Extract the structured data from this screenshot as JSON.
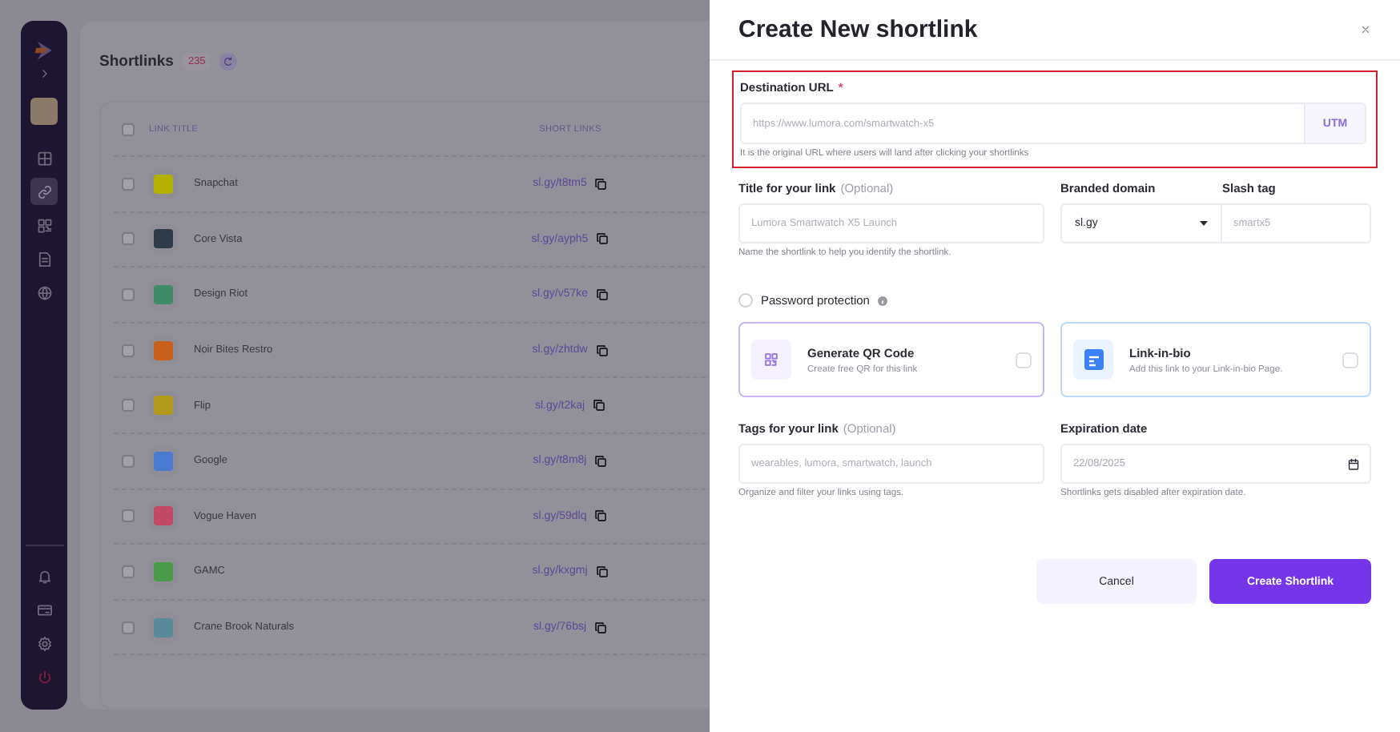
{
  "sidebar": {
    "top_items": [
      {
        "selected": false
      },
      {
        "selected": true
      },
      {
        "selected": false
      },
      {
        "selected": false
      },
      {
        "selected": false
      }
    ]
  },
  "page": {
    "title": "Shortlinks",
    "count": "235"
  },
  "table": {
    "columns": [
      "LINK TITLE",
      "SHORT LINKS"
    ],
    "header_checked": false,
    "rows": [
      {
        "title": "Snapchat",
        "short_link": "sl.gy/t8tm5",
        "color": "#b3b000",
        "checked": false
      },
      {
        "title": "Core Vista",
        "short_link": "sl.gy/ayph5",
        "color": "#2e3a4a",
        "checked": false
      },
      {
        "title": "Design Riot",
        "short_link": "sl.gy/v57ke",
        "color": "#3f8a6a",
        "checked": false
      },
      {
        "title": "Noir Bites Restro",
        "short_link": "sl.gy/zhtdw",
        "color": "#c8601c",
        "checked": false
      },
      {
        "title": "Flip",
        "short_link": "sl.gy/t2kaj",
        "color": "#b39a1c",
        "checked": false
      },
      {
        "title": "Google",
        "short_link": "sl.gy/t8m8j",
        "color": "#4a7ad0",
        "checked": false
      },
      {
        "title": "Vogue Haven",
        "short_link": "sl.gy/59dlq",
        "color": "#c24868",
        "checked": false
      },
      {
        "title": "GAMC",
        "short_link": "sl.gy/kxgmj",
        "color": "#4a9a4a",
        "checked": false
      },
      {
        "title": "Crane Brook Naturals",
        "short_link": "sl.gy/76bsj",
        "color": "#5a8a9a",
        "checked": false
      }
    ]
  },
  "dialog": {
    "title": "Create New shortlink",
    "destination": {
      "label": "Destination URL",
      "required": "*",
      "placeholder": "https://www.lumora.com/smartwatch-x5",
      "button": "UTM",
      "hint": "It is the original URL where users will land after clicking your shortlinks"
    },
    "link_title": {
      "label": "Title for your link",
      "optional": "(Optional)",
      "placeholder": "Lumora Smartwatch X5 Launch",
      "hint": "Name the shortlink to help you identify the shortlink."
    },
    "branded_domain": {
      "label": "Branded domain",
      "value": "sl.gy"
    },
    "slash_tag": {
      "label": "Slash tag",
      "placeholder": "smartx5"
    },
    "password": {
      "label": "Password protection",
      "checked": false
    },
    "options": [
      {
        "kind": "qr",
        "title": "Generate QR Code",
        "description": "Create free QR for this link",
        "checked": false
      },
      {
        "kind": "bio",
        "title": "Link-in-bio",
        "description": "Add this link to your Link-in-bio Page.",
        "checked": false
      }
    ],
    "tags": {
      "label": "Tags for your link",
      "optional": "(Optional)",
      "placeholder": "wearables, lumora, smartwatch, launch",
      "hint": "Organize and filter your links using tags."
    },
    "expiration": {
      "label": "Expiration date",
      "value": "22/08/2025",
      "hint": "Shortlinks gets disabled after expiration  date."
    },
    "buttons": {
      "cancel": "Cancel",
      "create": "Create Shortlink"
    }
  }
}
